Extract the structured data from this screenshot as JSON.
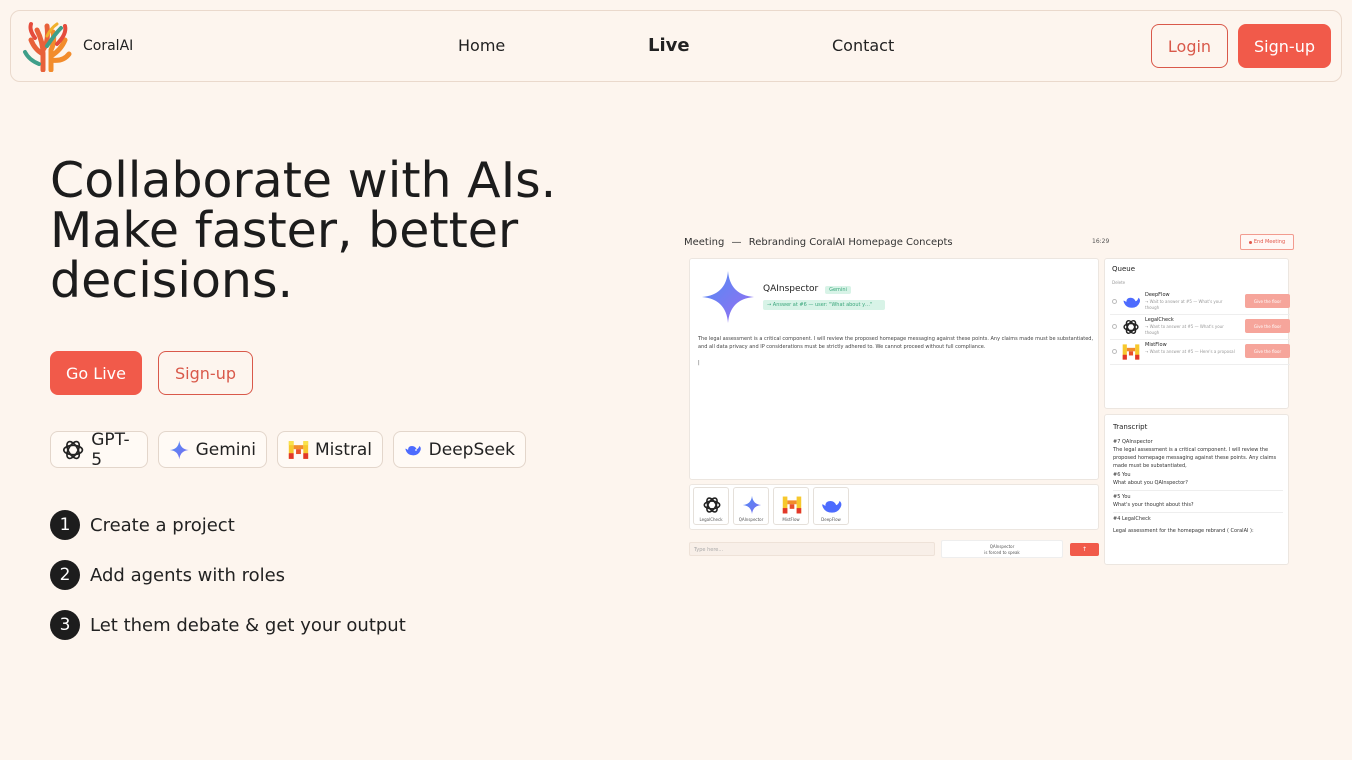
{
  "nav": {
    "brand": "CoralAI",
    "links": [
      "Home",
      "Live",
      "Contact"
    ],
    "login": "Login",
    "signup": "Sign-up"
  },
  "hero": {
    "title_line1": "Collaborate with AIs.",
    "title_line2": "Make faster, better",
    "title_line3": "decisions.",
    "go_live": "Go Live",
    "signup": "Sign-up"
  },
  "models": [
    "GPT-5",
    "Gemini",
    "Mistral",
    "DeepSeek"
  ],
  "steps": [
    {
      "num": "1",
      "text": "Create a project"
    },
    {
      "num": "2",
      "text": "Add agents with roles"
    },
    {
      "num": "3",
      "text": "Let them debate & get your output"
    }
  ],
  "preview": {
    "meeting_label": "Meeting",
    "dash": "—",
    "meeting_title": "Rebranding CoralAI Homepage Concepts",
    "time": "16:29",
    "end_meeting": "End Meeting",
    "speaker_name": "QAInspector",
    "speaker_model": "Gemini",
    "speaker_answer": "→ Answer at #6 — user: \"What about y…\"",
    "speaker_text": "The legal assessment is a critical component. I will review the proposed homepage messaging against these points. Any claims made must be substantiated, and all data privacy and IP considerations must be strictly adhered to. We cannot proceed without full compliance.",
    "cursor": "|",
    "agents": [
      "LegalCheck",
      "QAInspector",
      "MistFlow",
      "DeepFlow"
    ],
    "input_placeholder": "Type here...",
    "forced_name": "QAInspector",
    "forced_text": "is forced to speak",
    "send": "↑",
    "queue_title": "Queue",
    "queue_sub": "Delete",
    "queue": [
      {
        "name": "DeepFlow",
        "sub": "→ Wait to answer at #5 — What's your though",
        "btn": "Give the floor"
      },
      {
        "name": "LegalCheck",
        "sub": "→ Want to answer at #5 — What's your though",
        "btn": "Give the floor"
      },
      {
        "name": "MistFlow",
        "sub": "→ Want to answer at #5 — Here's a proposal",
        "btn": "Give the floor"
      }
    ],
    "transcript_title": "Transcript",
    "transcript": [
      {
        "head": "#7   QAInspector",
        "text": "The legal assessment is a critical component. I will review the proposed homepage messaging against these points. Any claims made must be substantiated,"
      },
      {
        "head": "#6   You",
        "text": "What about you QAInspector?"
      },
      {
        "head": "#5   You",
        "text": "What's your thought about this?"
      },
      {
        "head": "#4   LegalCheck",
        "text": "Legal assessment for the homepage rebrand ( CoralAI ):"
      }
    ]
  },
  "colors": {
    "accent": "#f15a4a",
    "background": "#fdf5ee",
    "dark": "#1d1d1d"
  }
}
